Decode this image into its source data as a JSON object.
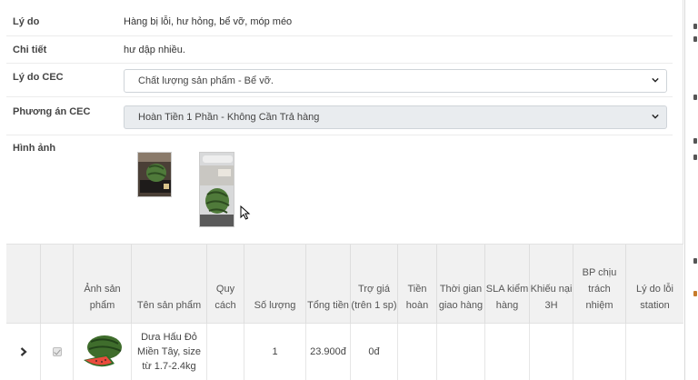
{
  "fields": {
    "reason_label": "Lý do",
    "reason_value": "Hàng bị lỗi, hư hỏng, bể vỡ, móp méo",
    "detail_label": "Chi tiết",
    "detail_value": "hư dập nhiều.",
    "cec_reason_label": "Lý do CEC",
    "cec_reason_value": "Chất lượng sản phẩm - Bể vỡ.",
    "cec_option_label": "Phương án CEC",
    "cec_option_value": "Hoàn Tiền 1 Phần - Không Cần Trả hàng",
    "images_label": "Hình ảnh"
  },
  "table": {
    "headers": {
      "image": "Ảnh sản phẩm",
      "name": "Tên sản phẩm",
      "spec": "Quy cách",
      "qty": "Số lượng",
      "total": "Tổng tiền",
      "subsidy": "Trợ giá (trên 1 sp)",
      "refund": "Tiền hoàn",
      "delivery_time": "Thời gian giao hàng",
      "sla": "SLA kiểm hàng",
      "complaint": "Khiếu nại 3H",
      "responsible": "BP chịu trách nhiệm",
      "station_reason": "Lý do lỗi station"
    },
    "rows": [
      {
        "name": "Dưa Hấu Đỏ Miền Tây, size từ 1.7-2.4kg",
        "spec": "",
        "qty": "1",
        "total": "23.900đ",
        "subsidy": "0đ",
        "refund": "",
        "delivery_time": "",
        "sla": "",
        "complaint": "",
        "responsible": "",
        "station_reason": ""
      }
    ]
  },
  "colors": {
    "header_bg": "#f1f1f1",
    "select_grey": "#e9ecef",
    "border": "#e2e2e2"
  },
  "icons": [
    "chevron-down-icon",
    "expand-arrow-icon",
    "checkbox-icon",
    "mouse-cursor-icon"
  ]
}
